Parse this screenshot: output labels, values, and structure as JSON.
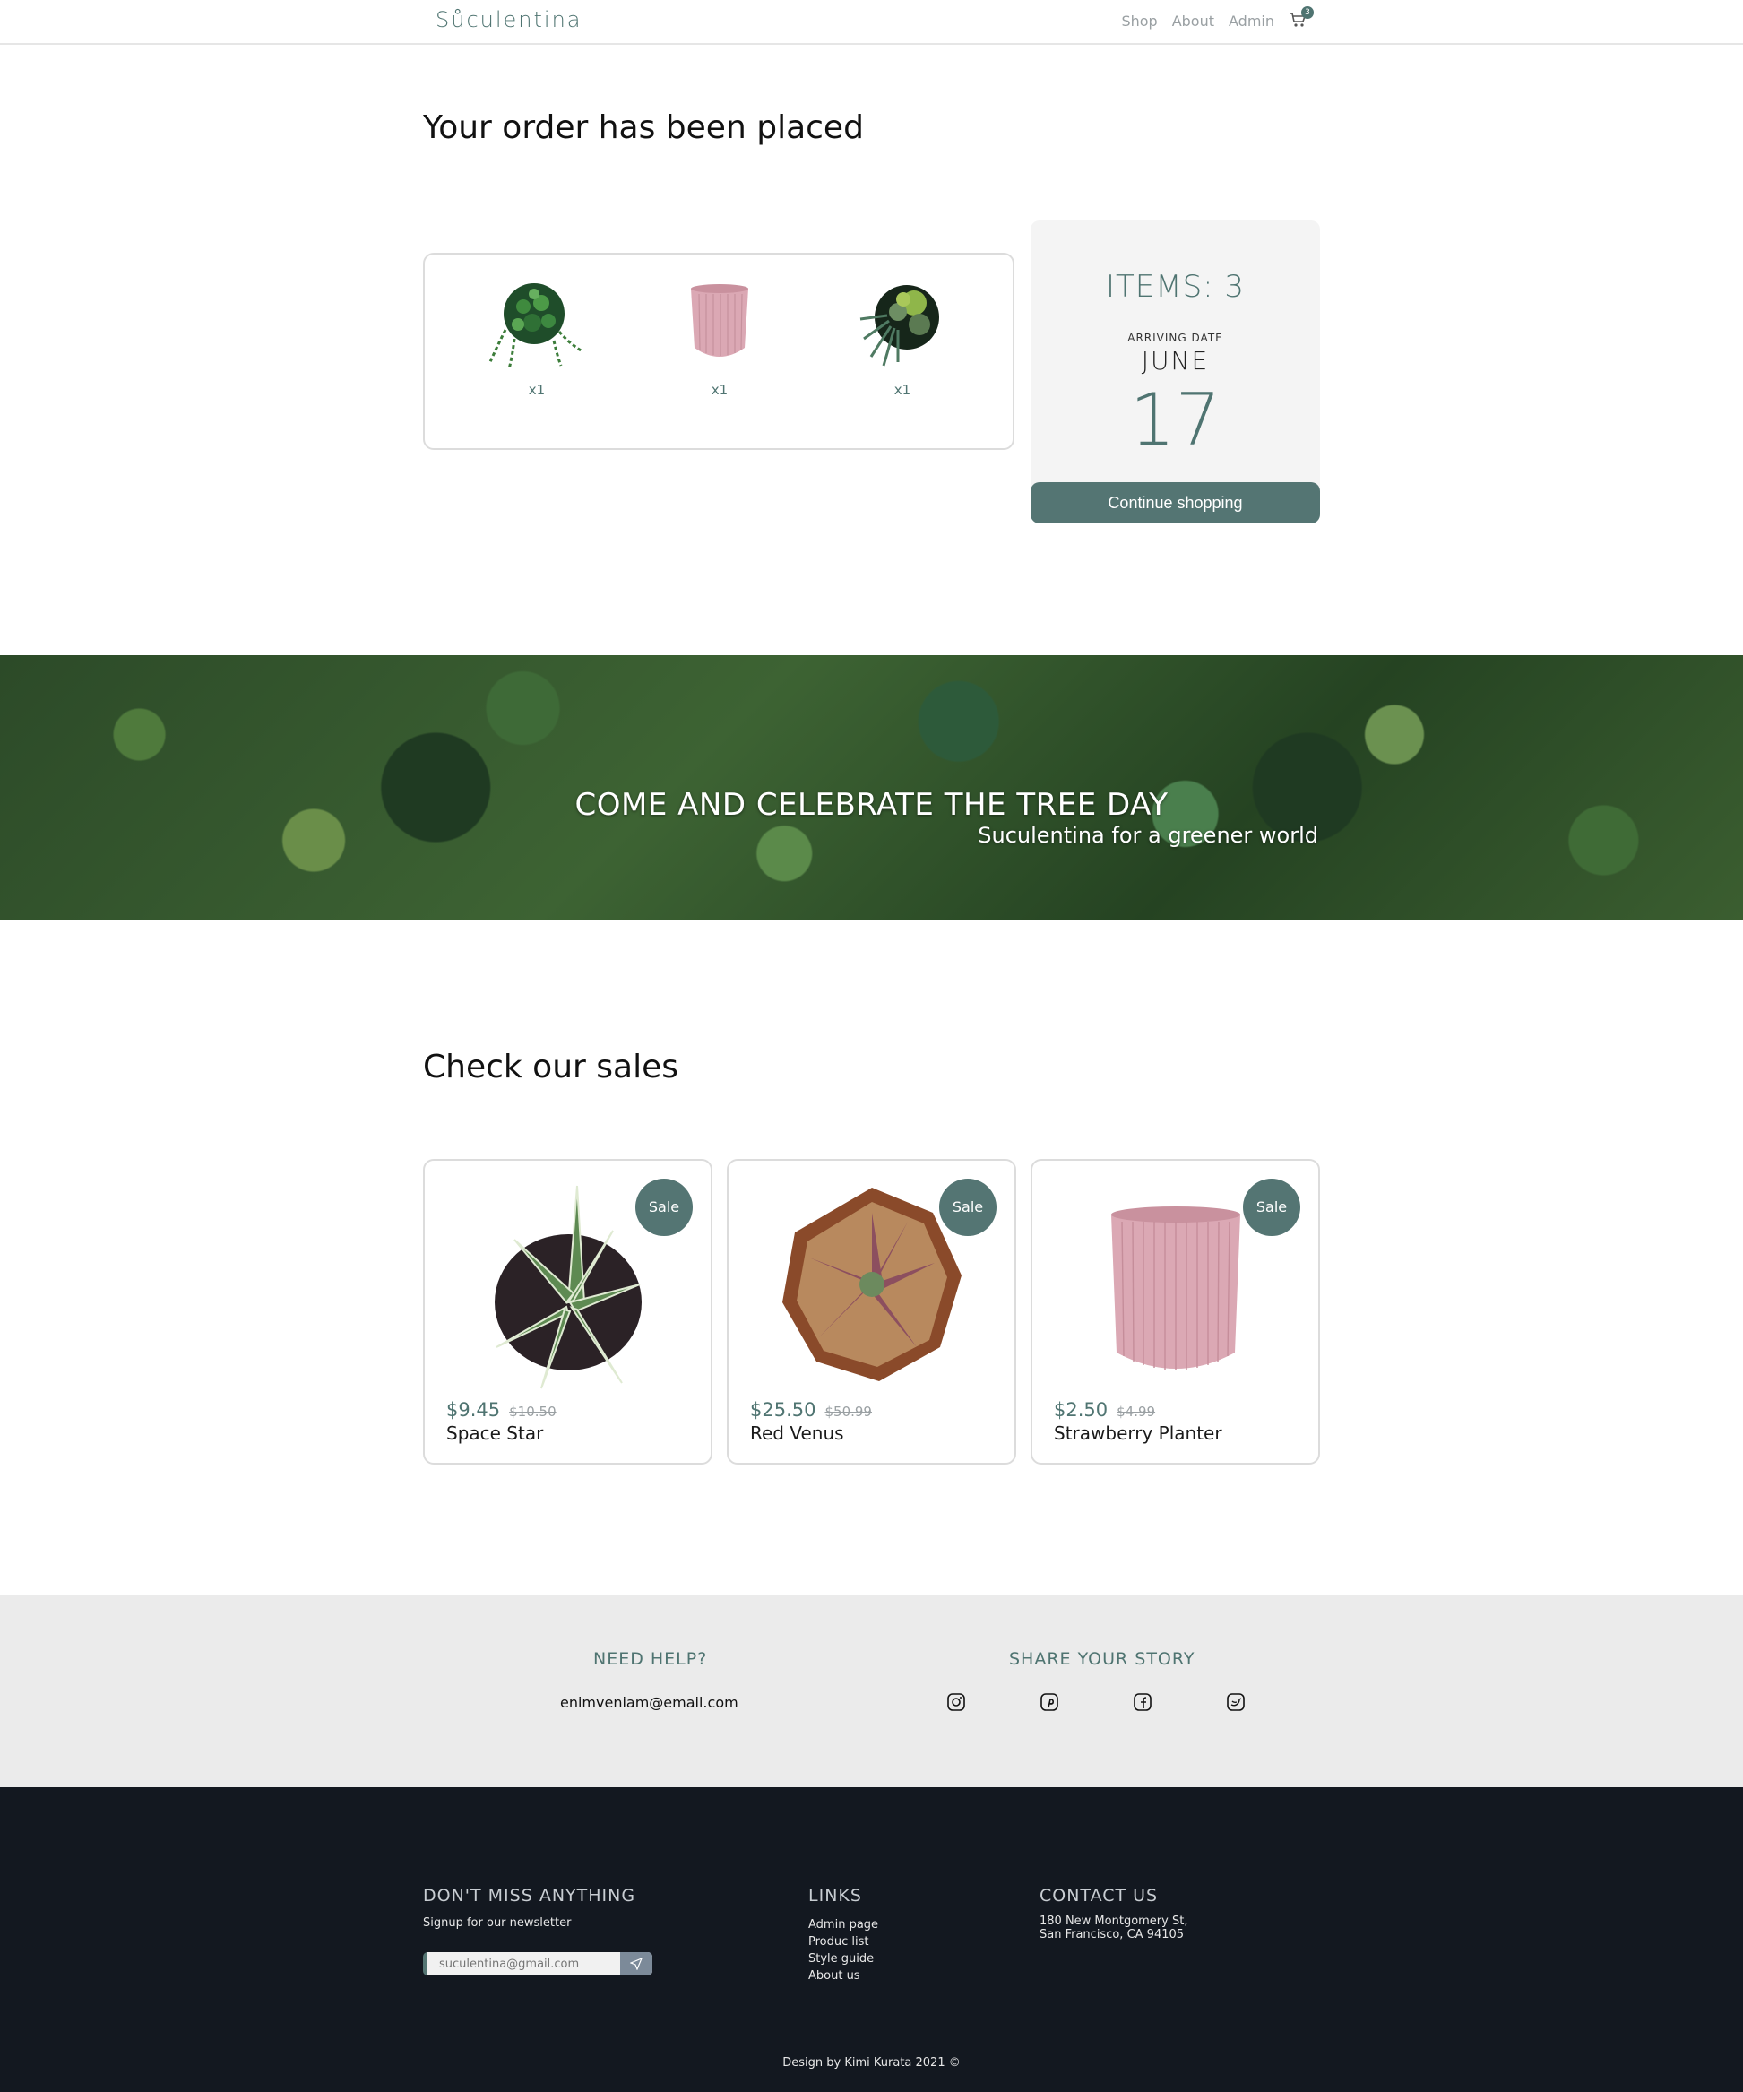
{
  "header": {
    "logo": "Sůculentina",
    "nav": [
      "Shop",
      "About",
      "Admin"
    ],
    "cart_count": "3"
  },
  "order": {
    "title": "Your order has been placed",
    "items": [
      {
        "qty": "x1",
        "image": "string-of-pearls-plant"
      },
      {
        "qty": "x1",
        "image": "pink-planter"
      },
      {
        "qty": "x1",
        "image": "succulent-arrangement"
      }
    ],
    "summary": {
      "items_label": "ITEMS: 3",
      "arriving_label": "ARRIVING DATE",
      "month": "JUNE",
      "day": "17",
      "button": "Continue shopping"
    }
  },
  "banner": {
    "title": "COME AND CELEBRATE THE TREE DAY",
    "subtitle": "Suculentina for a greener world"
  },
  "sales": {
    "title": "Check our sales",
    "badge": "Sale",
    "products": [
      {
        "price": "$9.45",
        "old_price": "$10.50",
        "name": "Space Star"
      },
      {
        "price": "$25.50",
        "old_price": "$50.99",
        "name": "Red Venus"
      },
      {
        "price": "$2.50",
        "old_price": "$4.99",
        "name": "Strawberry Planter"
      }
    ]
  },
  "help": {
    "need_help": "NEED HELP?",
    "email": "enimveniam@email.com",
    "share": "SHARE YOUR STORY",
    "social_icons": [
      "instagram-icon",
      "pinterest-icon",
      "facebook-icon",
      "twitter-icon"
    ]
  },
  "footer": {
    "newsletter_title": "DON'T MISS ANYTHING",
    "newsletter_sub": "Signup for our newsletter",
    "newsletter_placeholder": "suculentina@gmail.com",
    "links_title": "LINKS",
    "links": [
      "Admin page",
      "Produc list",
      "Style guide",
      "About us"
    ],
    "contact_title": "CONTACT US",
    "address_line1": "180 New Montgomery St,",
    "address_line2": "San Francisco, CA 94105",
    "credit": "Design by Kimi Kurata 2021 ©"
  },
  "colors": {
    "accent": "#547573",
    "footer_bg": "#131820",
    "help_bg": "#ebebeb"
  }
}
